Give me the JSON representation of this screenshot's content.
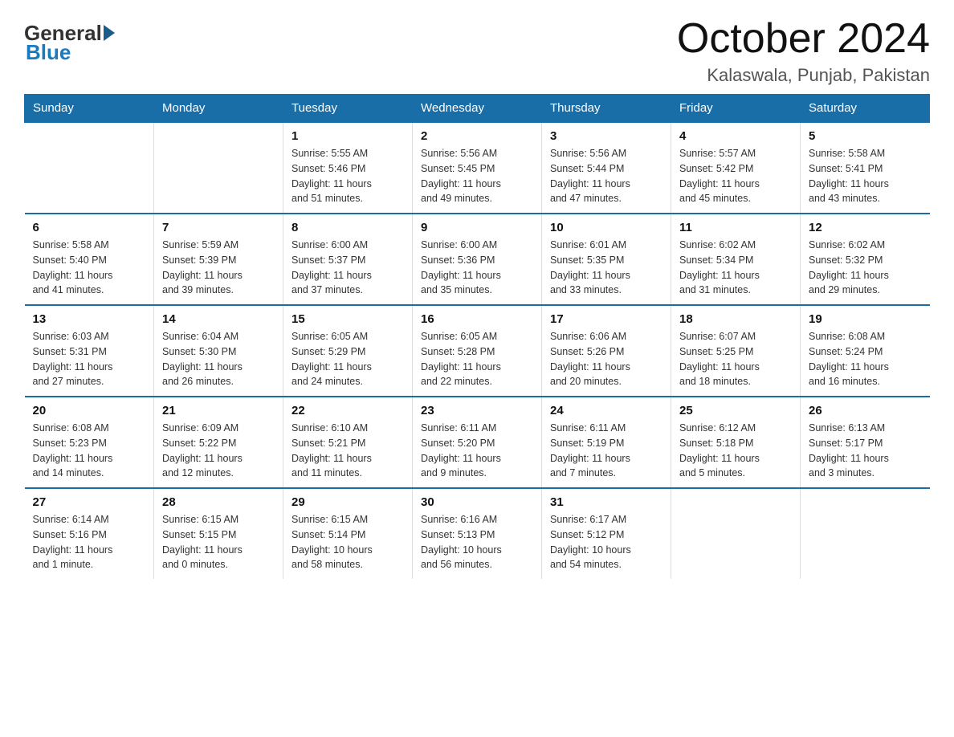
{
  "logo": {
    "general": "General",
    "blue": "Blue"
  },
  "title": "October 2024",
  "subtitle": "Kalaswala, Punjab, Pakistan",
  "headers": [
    "Sunday",
    "Monday",
    "Tuesday",
    "Wednesday",
    "Thursday",
    "Friday",
    "Saturday"
  ],
  "weeks": [
    [
      {
        "day": "",
        "info": ""
      },
      {
        "day": "",
        "info": ""
      },
      {
        "day": "1",
        "info": "Sunrise: 5:55 AM\nSunset: 5:46 PM\nDaylight: 11 hours\nand 51 minutes."
      },
      {
        "day": "2",
        "info": "Sunrise: 5:56 AM\nSunset: 5:45 PM\nDaylight: 11 hours\nand 49 minutes."
      },
      {
        "day": "3",
        "info": "Sunrise: 5:56 AM\nSunset: 5:44 PM\nDaylight: 11 hours\nand 47 minutes."
      },
      {
        "day": "4",
        "info": "Sunrise: 5:57 AM\nSunset: 5:42 PM\nDaylight: 11 hours\nand 45 minutes."
      },
      {
        "day": "5",
        "info": "Sunrise: 5:58 AM\nSunset: 5:41 PM\nDaylight: 11 hours\nand 43 minutes."
      }
    ],
    [
      {
        "day": "6",
        "info": "Sunrise: 5:58 AM\nSunset: 5:40 PM\nDaylight: 11 hours\nand 41 minutes."
      },
      {
        "day": "7",
        "info": "Sunrise: 5:59 AM\nSunset: 5:39 PM\nDaylight: 11 hours\nand 39 minutes."
      },
      {
        "day": "8",
        "info": "Sunrise: 6:00 AM\nSunset: 5:37 PM\nDaylight: 11 hours\nand 37 minutes."
      },
      {
        "day": "9",
        "info": "Sunrise: 6:00 AM\nSunset: 5:36 PM\nDaylight: 11 hours\nand 35 minutes."
      },
      {
        "day": "10",
        "info": "Sunrise: 6:01 AM\nSunset: 5:35 PM\nDaylight: 11 hours\nand 33 minutes."
      },
      {
        "day": "11",
        "info": "Sunrise: 6:02 AM\nSunset: 5:34 PM\nDaylight: 11 hours\nand 31 minutes."
      },
      {
        "day": "12",
        "info": "Sunrise: 6:02 AM\nSunset: 5:32 PM\nDaylight: 11 hours\nand 29 minutes."
      }
    ],
    [
      {
        "day": "13",
        "info": "Sunrise: 6:03 AM\nSunset: 5:31 PM\nDaylight: 11 hours\nand 27 minutes."
      },
      {
        "day": "14",
        "info": "Sunrise: 6:04 AM\nSunset: 5:30 PM\nDaylight: 11 hours\nand 26 minutes."
      },
      {
        "day": "15",
        "info": "Sunrise: 6:05 AM\nSunset: 5:29 PM\nDaylight: 11 hours\nand 24 minutes."
      },
      {
        "day": "16",
        "info": "Sunrise: 6:05 AM\nSunset: 5:28 PM\nDaylight: 11 hours\nand 22 minutes."
      },
      {
        "day": "17",
        "info": "Sunrise: 6:06 AM\nSunset: 5:26 PM\nDaylight: 11 hours\nand 20 minutes."
      },
      {
        "day": "18",
        "info": "Sunrise: 6:07 AM\nSunset: 5:25 PM\nDaylight: 11 hours\nand 18 minutes."
      },
      {
        "day": "19",
        "info": "Sunrise: 6:08 AM\nSunset: 5:24 PM\nDaylight: 11 hours\nand 16 minutes."
      }
    ],
    [
      {
        "day": "20",
        "info": "Sunrise: 6:08 AM\nSunset: 5:23 PM\nDaylight: 11 hours\nand 14 minutes."
      },
      {
        "day": "21",
        "info": "Sunrise: 6:09 AM\nSunset: 5:22 PM\nDaylight: 11 hours\nand 12 minutes."
      },
      {
        "day": "22",
        "info": "Sunrise: 6:10 AM\nSunset: 5:21 PM\nDaylight: 11 hours\nand 11 minutes."
      },
      {
        "day": "23",
        "info": "Sunrise: 6:11 AM\nSunset: 5:20 PM\nDaylight: 11 hours\nand 9 minutes."
      },
      {
        "day": "24",
        "info": "Sunrise: 6:11 AM\nSunset: 5:19 PM\nDaylight: 11 hours\nand 7 minutes."
      },
      {
        "day": "25",
        "info": "Sunrise: 6:12 AM\nSunset: 5:18 PM\nDaylight: 11 hours\nand 5 minutes."
      },
      {
        "day": "26",
        "info": "Sunrise: 6:13 AM\nSunset: 5:17 PM\nDaylight: 11 hours\nand 3 minutes."
      }
    ],
    [
      {
        "day": "27",
        "info": "Sunrise: 6:14 AM\nSunset: 5:16 PM\nDaylight: 11 hours\nand 1 minute."
      },
      {
        "day": "28",
        "info": "Sunrise: 6:15 AM\nSunset: 5:15 PM\nDaylight: 11 hours\nand 0 minutes."
      },
      {
        "day": "29",
        "info": "Sunrise: 6:15 AM\nSunset: 5:14 PM\nDaylight: 10 hours\nand 58 minutes."
      },
      {
        "day": "30",
        "info": "Sunrise: 6:16 AM\nSunset: 5:13 PM\nDaylight: 10 hours\nand 56 minutes."
      },
      {
        "day": "31",
        "info": "Sunrise: 6:17 AM\nSunset: 5:12 PM\nDaylight: 10 hours\nand 54 minutes."
      },
      {
        "day": "",
        "info": ""
      },
      {
        "day": "",
        "info": ""
      }
    ]
  ]
}
